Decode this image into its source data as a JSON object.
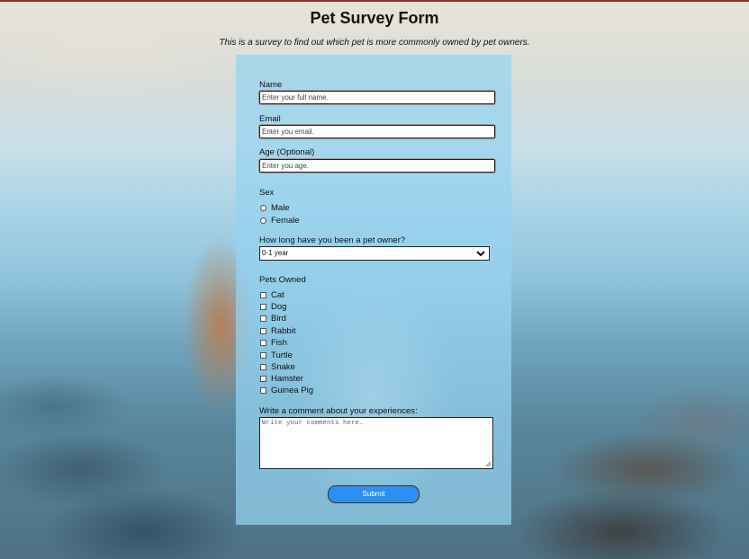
{
  "page": {
    "title": "Pet Survey Form",
    "subtitle": "This is a survey to find out which pet is more commonly owned by pet owners."
  },
  "form": {
    "name": {
      "label": "Name",
      "placeholder": "Enter your full name."
    },
    "email": {
      "label": "Email",
      "placeholder": "Enter you email."
    },
    "age": {
      "label": "Age (Optional)",
      "placeholder": "Enter you age."
    },
    "sex": {
      "label": "Sex",
      "options": [
        "Male",
        "Female"
      ]
    },
    "duration": {
      "label": "How long have you been a pet owner?",
      "selected": "0-1 year"
    },
    "pets": {
      "label": "Pets Owned",
      "options": [
        "Cat",
        "Dog",
        "Bird",
        "Rabbit",
        "Fish",
        "Turtle",
        "Snake",
        "Hamster",
        "Guinea Pig"
      ]
    },
    "comment": {
      "label": "Write a comment about your experiences:",
      "placeholder": "Write your comments here."
    },
    "submit_label": "Submit"
  },
  "colors": {
    "panel": "#96d2f0",
    "submit": "#2e8ff0"
  },
  "icons": {
    "select": "chevron-down-icon"
  }
}
